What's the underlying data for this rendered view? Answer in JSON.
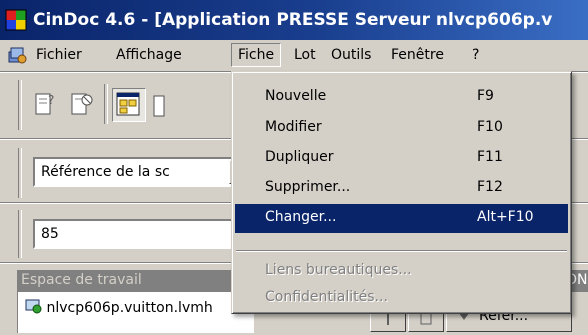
{
  "window": {
    "title": "CinDoc 4.6 - [Application PRESSE Serveur nlvcp606p.v"
  },
  "menubar": {
    "items": [
      "Fichier",
      "Affichage",
      "Fiche",
      "Lot",
      "Outils",
      "Fenêtre",
      "?"
    ]
  },
  "fiche_menu": {
    "items": [
      {
        "label": "Nouvelle",
        "shortcut": "F9",
        "state": "enabled"
      },
      {
        "label": "Modifier",
        "shortcut": "F10",
        "state": "enabled"
      },
      {
        "label": "Dupliquer",
        "shortcut": "F11",
        "state": "enabled"
      },
      {
        "label": "Supprimer...",
        "shortcut": "F12",
        "state": "enabled"
      },
      {
        "label": "Changer...",
        "shortcut": "Alt+F10",
        "state": "selected"
      },
      {
        "label": "Liens bureautiques...",
        "shortcut": "",
        "state": "disabled"
      },
      {
        "label": "Confidentialités...",
        "shortcut": "",
        "state": "disabled"
      }
    ]
  },
  "search": {
    "reference_combo": "Référence de la sc",
    "value_field": "85"
  },
  "workspace": {
    "title": "Espace de travail",
    "tree_item": "nlvcp606p.vuitton.lvmh"
  },
  "right_pane": {
    "header_fragment": "ON",
    "tab_label": "Réfer..."
  },
  "colors": {
    "selection": "#0a246a",
    "face": "#d4d0c8",
    "disabled_text": "#808080"
  }
}
